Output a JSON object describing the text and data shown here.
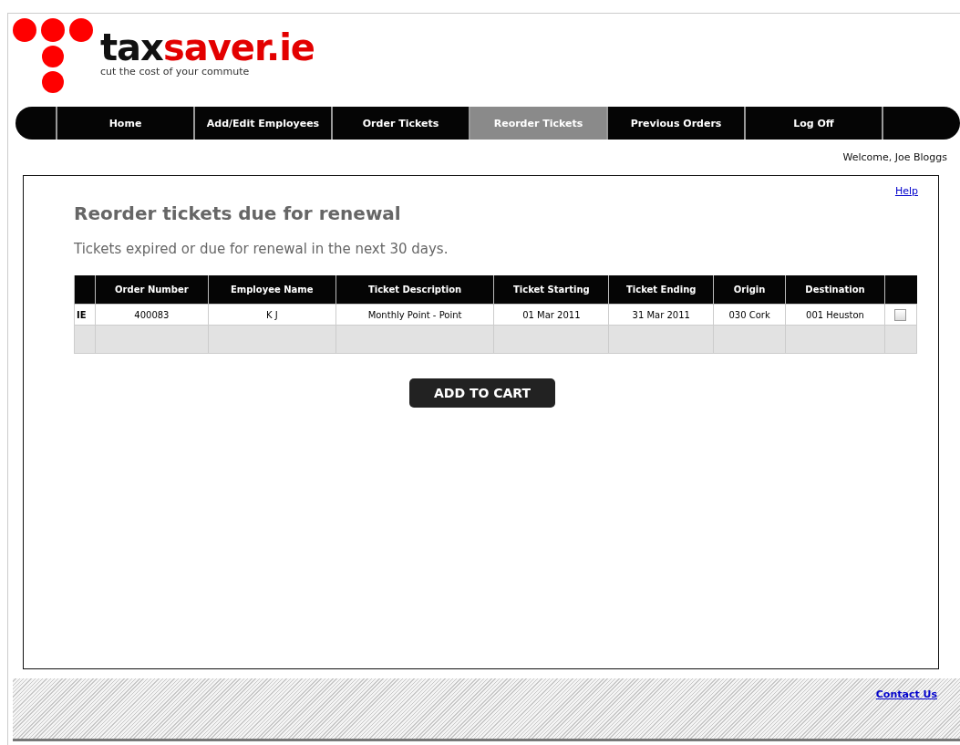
{
  "logo": {
    "dark": "tax",
    "accent": "saver.ie",
    "tagline": "cut the cost of your commute"
  },
  "nav": [
    {
      "label": "Home",
      "selected": false
    },
    {
      "label": "Add/Edit Employees",
      "selected": false
    },
    {
      "label": "Order Tickets",
      "selected": false
    },
    {
      "label": "Reorder Tickets",
      "selected": true
    },
    {
      "label": "Previous Orders",
      "selected": false
    },
    {
      "label": "Log Off",
      "selected": false
    }
  ],
  "welcome": "Welcome, Joe Bloggs",
  "help_link": "Help",
  "heading": "Reorder tickets due for renewal",
  "subtitle": "Tickets expired or due for renewal in the next 30 days.",
  "table": {
    "columns": [
      "Order Number",
      "Employee Name",
      "Ticket Description",
      "Ticket Starting",
      "Ticket Ending",
      "Origin",
      "Destination"
    ],
    "rows": [
      {
        "kind": "ticket",
        "flag": "IE",
        "cells": [
          "400083",
          "K J",
          "Monthly Point - Point",
          "01 Mar 2011",
          "31 Mar 2011",
          "030 Cork",
          "001 Heuston"
        ],
        "checked": false
      },
      {
        "kind": "empty"
      }
    ]
  },
  "add_button": "ADD TO CART",
  "footer": {
    "contact_link": "Contact Us"
  }
}
